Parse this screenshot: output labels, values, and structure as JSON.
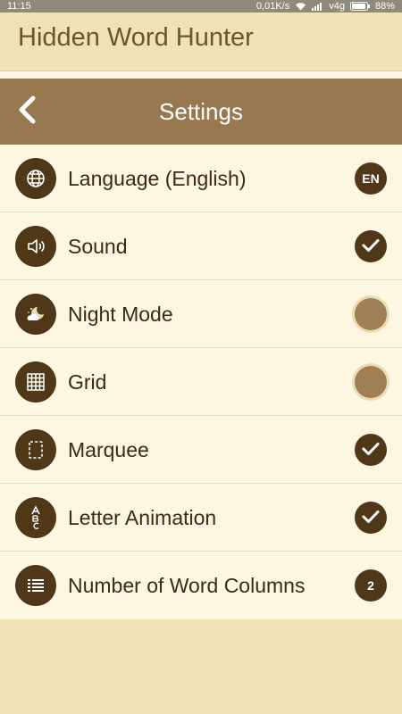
{
  "status_bar": {
    "time": "11:15",
    "network_speed": "0,01K/s",
    "network_type": "v4g",
    "battery": "88%"
  },
  "app": {
    "title": "Hidden Word Hunter"
  },
  "header": {
    "title": "Settings",
    "back_icon": "chevron-left-icon"
  },
  "settings": [
    {
      "label": "Language (English)",
      "icon": "globe-icon",
      "control": "badge",
      "badge_text": "EN"
    },
    {
      "label": "Sound",
      "icon": "speaker-icon",
      "control": "toggle",
      "enabled": true
    },
    {
      "label": "Night Mode",
      "icon": "moon-cloud-icon",
      "control": "toggle",
      "enabled": false
    },
    {
      "label": "Grid",
      "icon": "grid-icon",
      "control": "toggle",
      "enabled": false
    },
    {
      "label": "Marquee",
      "icon": "marquee-icon",
      "control": "toggle",
      "enabled": true
    },
    {
      "label": "Letter Animation",
      "icon": "letters-icon",
      "control": "toggle",
      "enabled": true
    },
    {
      "label": "Number of Word Columns",
      "icon": "list-columns-icon",
      "control": "badge",
      "badge_text": "2"
    }
  ],
  "colors": {
    "header_bg": "#98784f",
    "icon_bg": "#4f3718",
    "list_bg": "#fdf6e0",
    "page_bg": "#efe2b4",
    "off_toggle": "#9f7f53"
  }
}
